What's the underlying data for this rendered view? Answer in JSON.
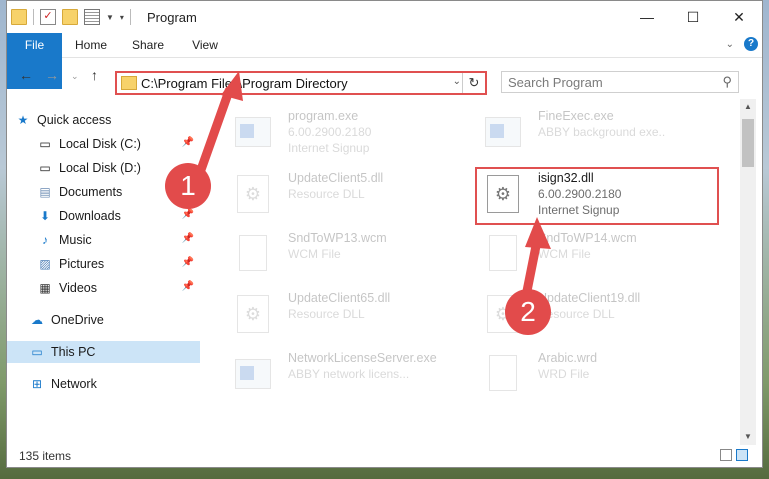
{
  "window": {
    "title": "Program",
    "controls": {
      "minimize": "—",
      "maximize": "☐",
      "close": "✕"
    }
  },
  "ribbon": {
    "tabs": [
      "File",
      "Home",
      "Share",
      "View"
    ]
  },
  "address": {
    "path": "C:\\Program Files\\Program Directory"
  },
  "search": {
    "placeholder": "Search Program"
  },
  "sidebar": {
    "items": [
      {
        "label": "Quick access"
      },
      {
        "label": "Local Disk (C:)"
      },
      {
        "label": "Local Disk (D:)"
      },
      {
        "label": "Documents"
      },
      {
        "label": "Downloads"
      },
      {
        "label": "Music"
      },
      {
        "label": "Pictures"
      },
      {
        "label": "Videos"
      },
      {
        "label": "OneDrive"
      },
      {
        "label": "This PC"
      },
      {
        "label": "Network"
      }
    ]
  },
  "files": [
    {
      "name": "program.exe",
      "line1": "6.00.2900.2180",
      "line2": "Internet Signup"
    },
    {
      "name": "FineExec.exe",
      "line1": "ABBY background exe..",
      "line2": ""
    },
    {
      "name": "UpdateClient5.dll",
      "line1": "Resource DLL",
      "line2": ""
    },
    {
      "name": "isign32.dll",
      "line1": "6.00.2900.2180",
      "line2": "Internet Signup"
    },
    {
      "name": "SndToWP13.wcm",
      "line1": "WCM File",
      "line2": ""
    },
    {
      "name": "SndToWP14.wcm",
      "line1": "WCM File",
      "line2": ""
    },
    {
      "name": "UpdateClient65.dll",
      "line1": "Resource DLL",
      "line2": ""
    },
    {
      "name": "UpdateClient19.dll",
      "line1": "Resource DLL",
      "line2": ""
    },
    {
      "name": "NetworkLicenseServer.exe",
      "line1": "ABBY network licens...",
      "line2": ""
    },
    {
      "name": "Arabic.wrd",
      "line1": "WRD File",
      "line2": ""
    }
  ],
  "status": {
    "count": "135 items"
  },
  "annotations": {
    "step1": "1",
    "step2": "2"
  },
  "colors": {
    "accent": "#1979ca",
    "highlight": "#e05050",
    "selected": "#cce4f7"
  }
}
